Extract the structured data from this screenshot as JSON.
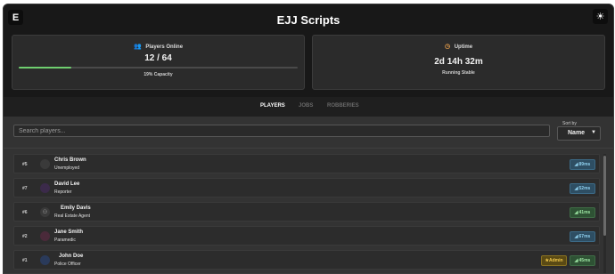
{
  "app": {
    "logo": "E",
    "title": "EJJ Scripts",
    "theme_icon": "sun-icon"
  },
  "stats": {
    "players": {
      "label": "Players Online",
      "icon": "users-icon",
      "value": "12 / 64",
      "sub": "19% Capacity",
      "progress": 0.19
    },
    "uptime": {
      "label": "Uptime",
      "icon": "clock-icon",
      "value": "2d 14h 32m",
      "sub": "Running Stable"
    }
  },
  "tabs": [
    {
      "label": "PLAYERS",
      "active": true
    },
    {
      "label": "JOBS",
      "active": false
    },
    {
      "label": "ROBBERIES",
      "active": false
    }
  ],
  "search": {
    "placeholder": "Search players..."
  },
  "sort": {
    "label": "Sort by",
    "value": "Name"
  },
  "players": [
    {
      "rank": "#5",
      "name": "Chris Brown",
      "job": "Unemployed",
      "ping": "89ms",
      "ping_color": "blue",
      "avatar_color": "#3a3a3a",
      "admin": ""
    },
    {
      "rank": "#7",
      "name": "David Lee",
      "job": "Reporter",
      "ping": "52ms",
      "ping_color": "blue",
      "avatar_color": "#3b2a4a",
      "admin": ""
    },
    {
      "rank": "#6",
      "name": "Emily Davis",
      "job": "Real Estate Agent",
      "ping": "41ms",
      "ping_color": "green",
      "avatar_color": "#3a3a3a",
      "admin": ""
    },
    {
      "rank": "#2",
      "name": "Jane Smith",
      "job": "Paramedic",
      "ping": "67ms",
      "ping_color": "blue",
      "avatar_color": "#4a2a3a",
      "admin": ""
    },
    {
      "rank": "#1",
      "name": "John Doe",
      "job": "Police Officer",
      "ping": "45ms",
      "ping_color": "green",
      "avatar_color": "#2a3a5a",
      "admin": "Admin"
    }
  ],
  "colors": {
    "accent_green": "#6fcf6f",
    "admin_gold": "#f2c94c",
    "ping_blue": "#8fd0ef",
    "ping_green": "#9be3a1"
  }
}
